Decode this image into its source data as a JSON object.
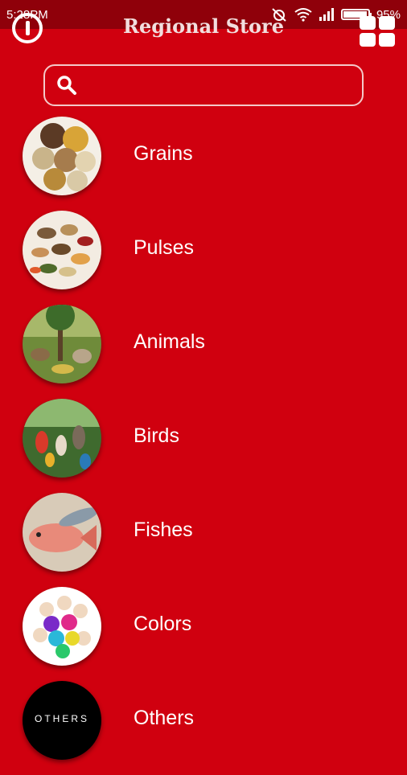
{
  "status": {
    "time": "5:28PM",
    "battery": "95%"
  },
  "appbar": {
    "title": "Regional Store"
  },
  "search": {
    "placeholder": "",
    "value": ""
  },
  "categories": [
    {
      "label": "Grains"
    },
    {
      "label": "Pulses"
    },
    {
      "label": "Animals"
    },
    {
      "label": "Birds"
    },
    {
      "label": "Fishes"
    },
    {
      "label": "Colors"
    },
    {
      "label": "Others",
      "thumb_text": "OTHERS"
    }
  ],
  "colors": {
    "background": "#d0000f",
    "statusbar": "#8f000a"
  }
}
